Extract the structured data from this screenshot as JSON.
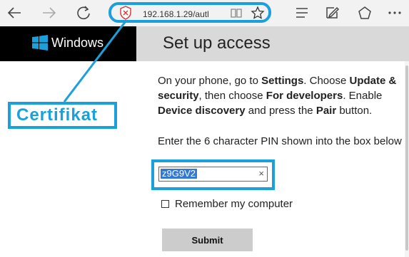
{
  "browser": {
    "url": "192.168.1.29/autl",
    "icons": [
      "back-icon",
      "forward-icon",
      "refresh-icon",
      "cert-error-icon",
      "reading-view-icon",
      "favorite-icon",
      "hub-icon",
      "note-icon",
      "share-icon",
      "more-icon"
    ]
  },
  "brand": {
    "name": "Windows"
  },
  "header": {
    "title": "Set up access"
  },
  "annotation": {
    "label": "Certifikat",
    "color": "#1aa0da"
  },
  "instructions": {
    "p1": "On your phone, go to ",
    "b1": "Settings",
    "p2": ". Choose ",
    "b2": "Update & security",
    "p3": ", then choose ",
    "b3": "For developers",
    "p4": ". Enable ",
    "b4": "Device discovery",
    "p5": " and press the ",
    "b5": "Pair",
    "p6": " button."
  },
  "pin": {
    "label": "Enter the 6 character PIN shown into the box below",
    "value": "z9G9V2",
    "clear_symbol": "×"
  },
  "remember": {
    "label": "Remember my computer",
    "checked": false
  },
  "submit": {
    "label": "Submit"
  }
}
